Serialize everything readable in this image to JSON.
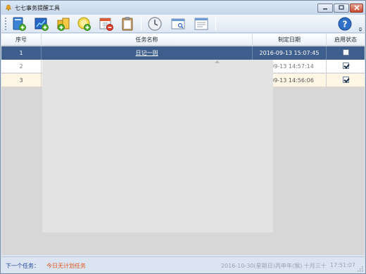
{
  "window": {
    "title": "七七事务提醒工具",
    "app_icon": "bell-icon",
    "controls": [
      {
        "name": "minimize",
        "icon": "minimize-icon"
      },
      {
        "name": "maximize",
        "icon": "maximize-icon"
      },
      {
        "name": "close",
        "icon": "close-icon"
      }
    ]
  },
  "toolbar": {
    "buttons": [
      {
        "name": "new-task",
        "icon": "new-document-icon"
      },
      {
        "name": "edit-task",
        "icon": "chart-edit-icon"
      },
      {
        "name": "task-group",
        "icon": "folder-add-icon"
      },
      {
        "name": "add-reminder",
        "icon": "add-circle-icon"
      },
      {
        "name": "delete-task",
        "icon": "calendar-delete-icon"
      },
      {
        "name": "clipboard",
        "icon": "clipboard-icon"
      },
      {
        "name": "clock",
        "icon": "clock-icon"
      },
      {
        "name": "search-window",
        "icon": "window-search-icon"
      },
      {
        "name": "window-settings",
        "icon": "window-list-icon"
      },
      {
        "name": "help",
        "icon": "help-icon"
      }
    ],
    "accent": "#3b6fc4"
  },
  "grid": {
    "columns": [
      "序号",
      "任务名称",
      "制定日期",
      "启用状态"
    ],
    "rows": [
      {
        "index": "1",
        "name": "日记一则",
        "date": "2016-09-13 15:07:45",
        "enabled": false,
        "selected": true
      },
      {
        "index": "2",
        "name": "",
        "date": "6-09-13 14:57:14",
        "enabled": true,
        "selected": false
      },
      {
        "index": "3",
        "name": "",
        "date": "6-09-13 14:56:06",
        "enabled": true,
        "selected": false
      }
    ],
    "selected_row_color": "#3e5f8e",
    "alt_row_color": "#fff6e6"
  },
  "status": {
    "next_task_label": "下一个任务：",
    "next_task_value": "今日无计划任务",
    "date": "2016-10-30(星期日)",
    "lunar": "丙申年(猴) 十月三十",
    "time": "17:51:07",
    "label_color": "#1f3f99",
    "value_color": "#e2531d"
  }
}
